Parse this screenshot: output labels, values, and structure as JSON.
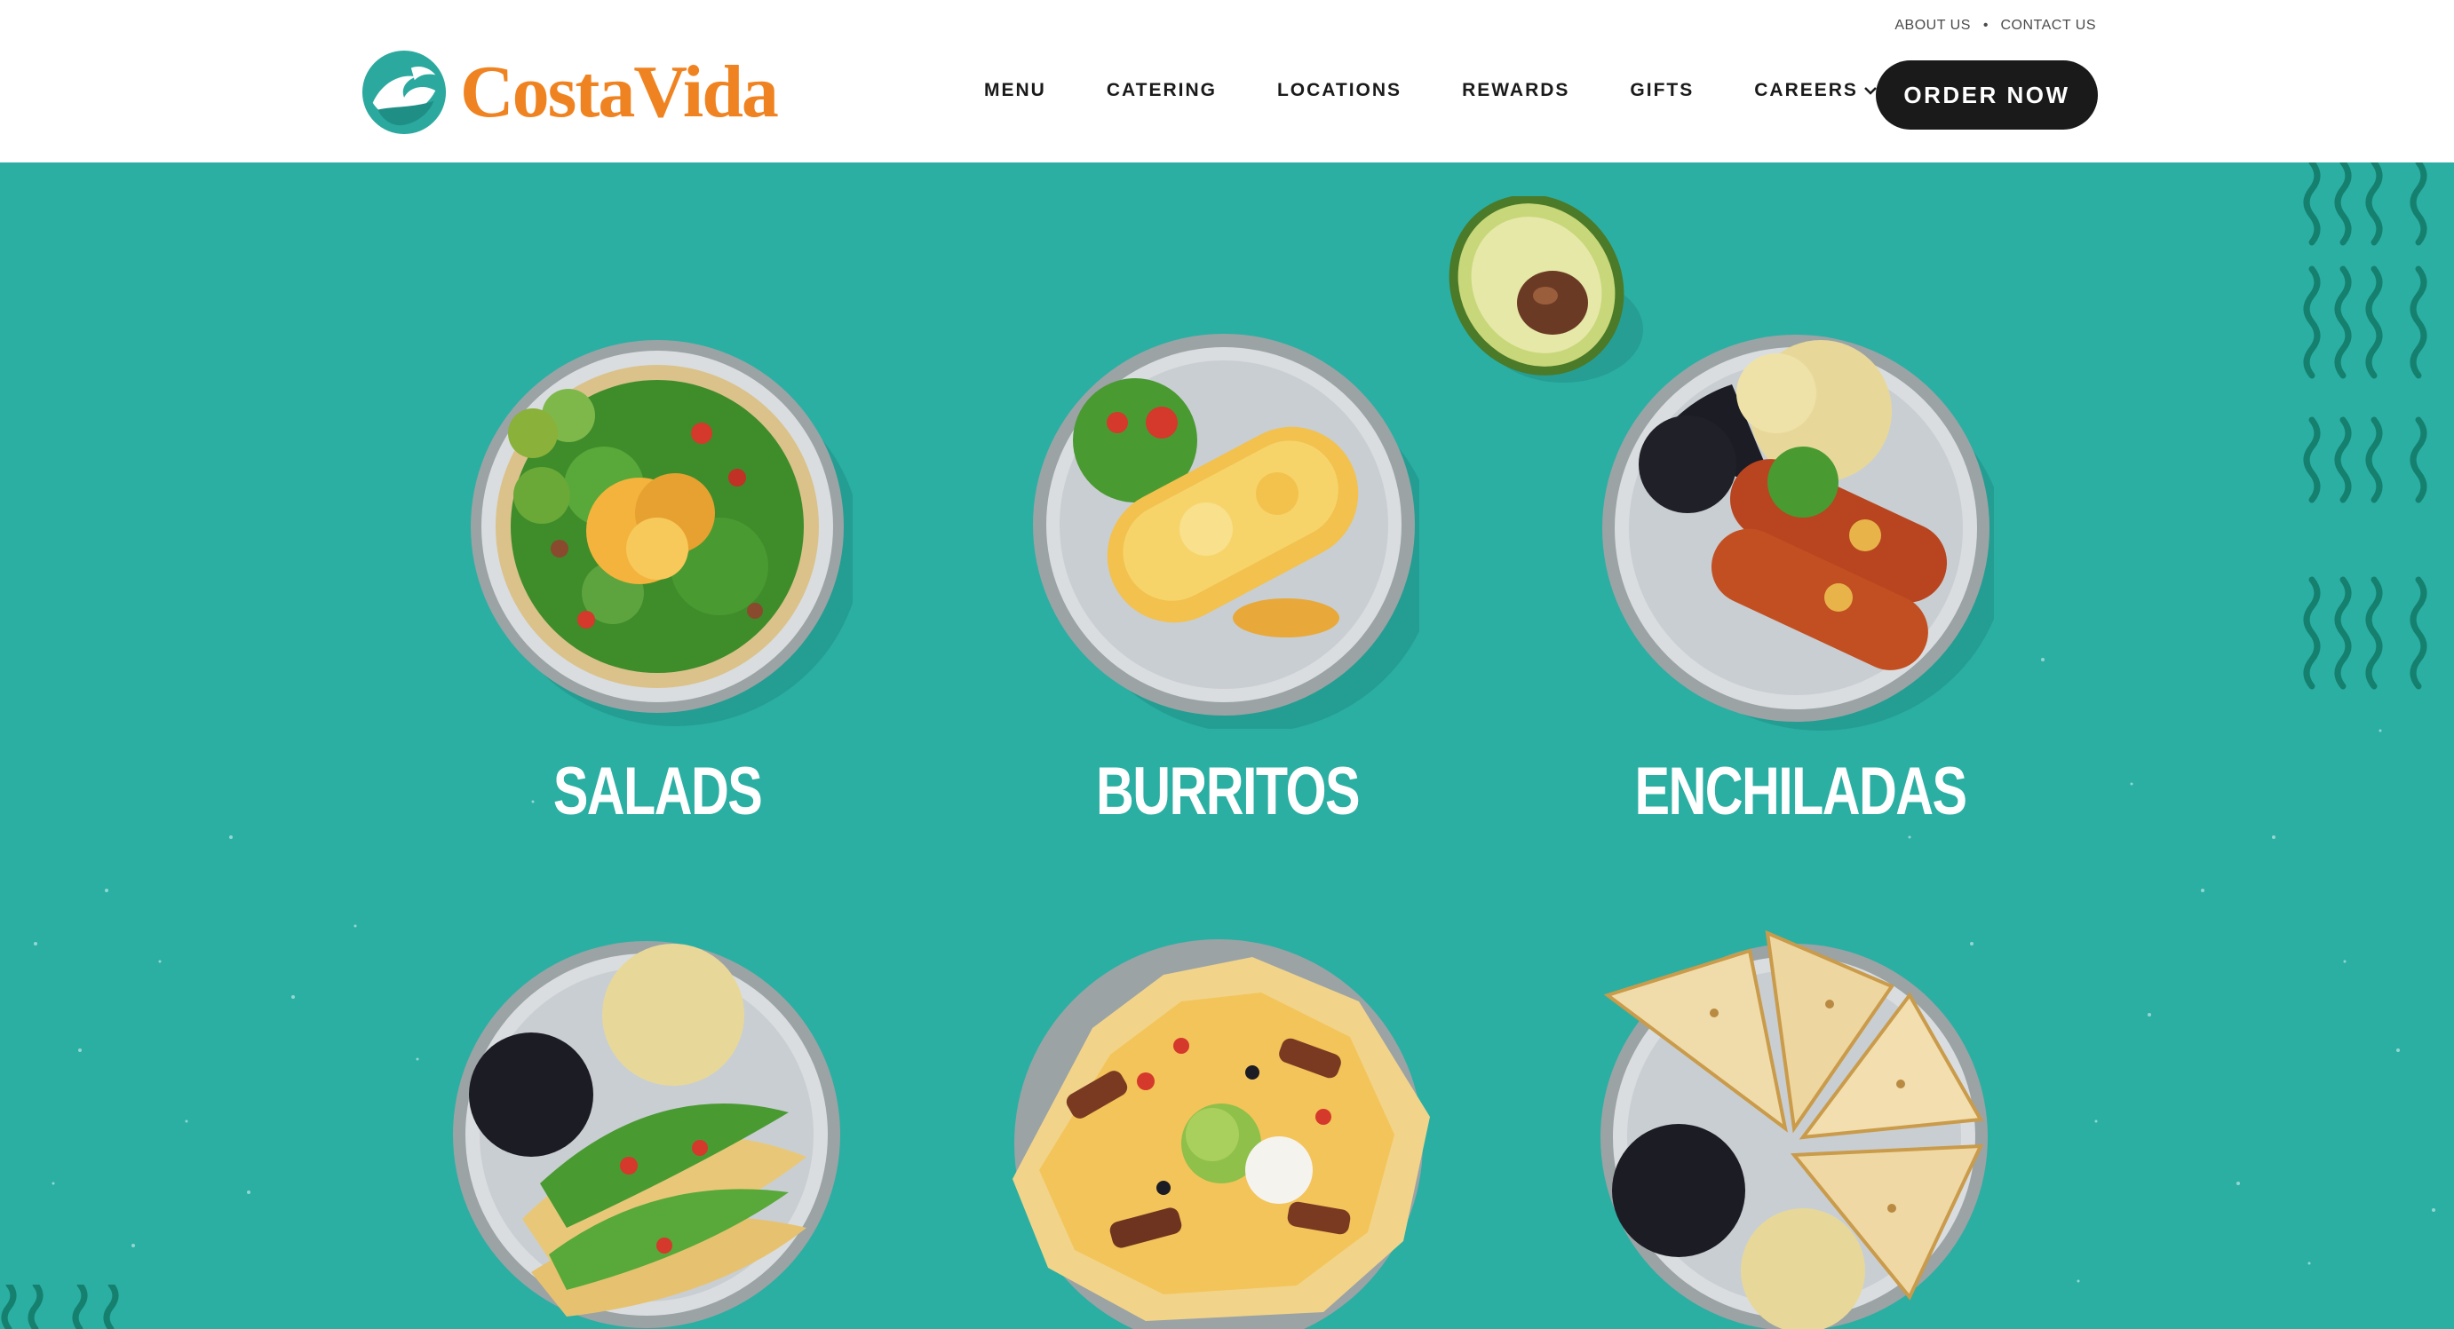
{
  "header": {
    "util_links": {
      "about": "ABOUT US",
      "separator": "•",
      "contact": "CONTACT US"
    },
    "logo_text": "CostaVida",
    "nav": {
      "menu": "MENU",
      "catering": "CATERING",
      "locations": "LOCATIONS",
      "rewards": "REWARDS",
      "gifts": "GIFTS",
      "careers": "CAREERS"
    },
    "order_button": "ORDER NOW"
  },
  "menu_categories": [
    {
      "name": "SALADS"
    },
    {
      "name": "BURRITOS"
    },
    {
      "name": "ENCHILADAS"
    }
  ],
  "icons": {
    "logo": "wave-logo-icon",
    "careers_dropdown": "chevron-down-icon"
  },
  "colors": {
    "background": "#2bafa3",
    "brand_orange": "#f08321",
    "button": "#1a1a1a",
    "header": "#ffffff"
  }
}
